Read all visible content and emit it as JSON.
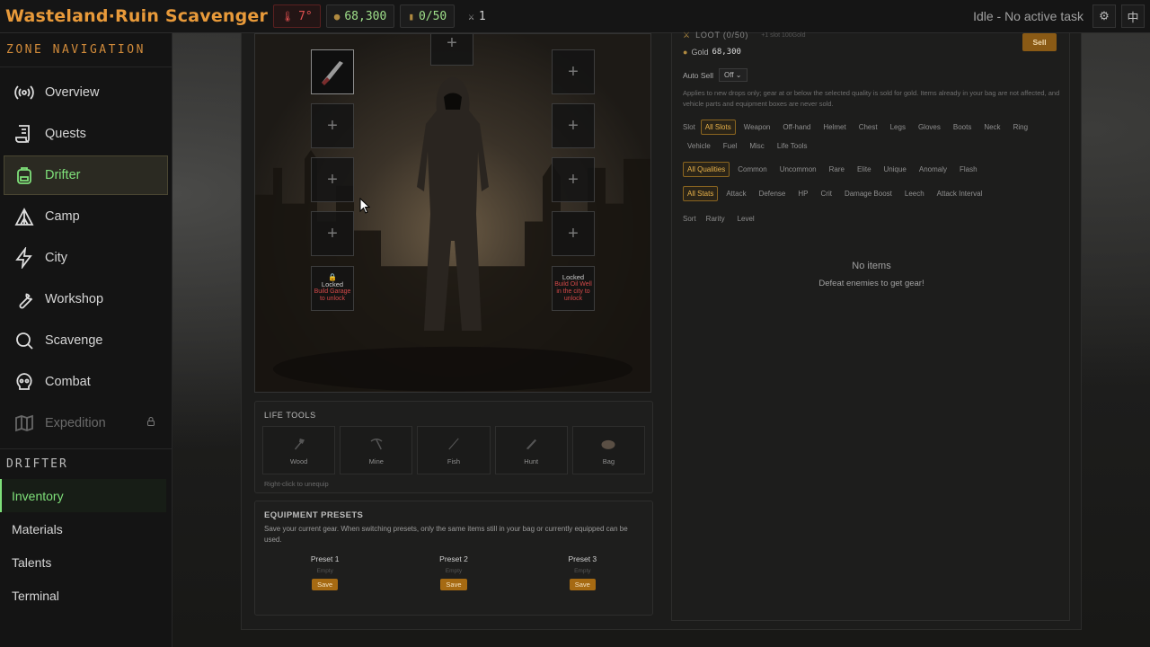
{
  "app": {
    "title": "Wasteland·Ruin Scavenger",
    "temperature": "7°",
    "gold": "68,300",
    "bag": "0/50",
    "combat": "1",
    "status": "Idle - No active task"
  },
  "sidebar": {
    "heading": "ZONE NAVIGATION",
    "items": [
      {
        "label": "Overview",
        "icon": "radio-waves-icon"
      },
      {
        "label": "Quests",
        "icon": "scroll-icon"
      },
      {
        "label": "Drifter",
        "icon": "backpack-icon",
        "active": true
      },
      {
        "label": "Camp",
        "icon": "tent-icon"
      },
      {
        "label": "City",
        "icon": "lightning-icon"
      },
      {
        "label": "Workshop",
        "icon": "wrench-icon"
      },
      {
        "label": "Scavenge",
        "icon": "search-icon"
      },
      {
        "label": "Combat",
        "icon": "skull-icon"
      },
      {
        "label": "Expedition",
        "icon": "map-icon",
        "locked": true
      }
    ],
    "sub_heading": "DRIFTER",
    "sub_items": [
      {
        "label": "Inventory",
        "active": true
      },
      {
        "label": "Materials"
      },
      {
        "label": "Talents"
      },
      {
        "label": "Terminal"
      }
    ]
  },
  "equipment": {
    "locked_left": {
      "title": "Locked",
      "reason": "Build Garage to unlock"
    },
    "locked_right": {
      "title": "Locked",
      "reason": "Build Oil Well in the city to unlock"
    }
  },
  "life_tools": {
    "title": "LIFE TOOLS",
    "slots": [
      "Wood",
      "Mine",
      "Fish",
      "Hunt",
      "Bag"
    ],
    "hint": "Right-click to unequip"
  },
  "presets": {
    "title": "EQUIPMENT PRESETS",
    "desc": "Save your current gear. When switching presets, only the same items still in your bag or currently equipped can be used.",
    "items": [
      {
        "name": "Preset 1",
        "state": "Empty",
        "save": "Save"
      },
      {
        "name": "Preset 2",
        "state": "Empty",
        "save": "Save"
      },
      {
        "name": "Preset 3",
        "state": "Empty",
        "save": "Save"
      }
    ]
  },
  "loot": {
    "title": "LOOT (0/50)",
    "sub": "+1 slot 100Gold",
    "sell": "Sell",
    "gold_label": "Gold",
    "gold_value": "68,300",
    "autosell_label": "Auto Sell",
    "autosell_value": "Off",
    "note": "Applies to new drops only; gear at or below the selected quality is sold for gold. Items already in your bag are not affected, and vehicle parts and equipment boxes are never sold.",
    "slot_label": "Slot",
    "slots": [
      "All Slots",
      "Weapon",
      "Off-hand",
      "Helmet",
      "Chest",
      "Legs",
      "Gloves",
      "Boots",
      "Neck",
      "Ring",
      "Vehicle",
      "Fuel",
      "Misc",
      "Life Tools"
    ],
    "qualities": [
      "All Qualities",
      "Common",
      "Uncommon",
      "Rare",
      "Elite",
      "Unique",
      "Anomaly",
      "Flash"
    ],
    "stats": [
      "All Stats",
      "Attack",
      "Defense",
      "HP",
      "Crit",
      "Damage Boost",
      "Leech",
      "Attack Interval"
    ],
    "sort_label": "Sort",
    "sorts": [
      "Rarity",
      "Level"
    ],
    "empty_title": "No items",
    "empty_sub": "Defeat enemies to get gear!"
  }
}
